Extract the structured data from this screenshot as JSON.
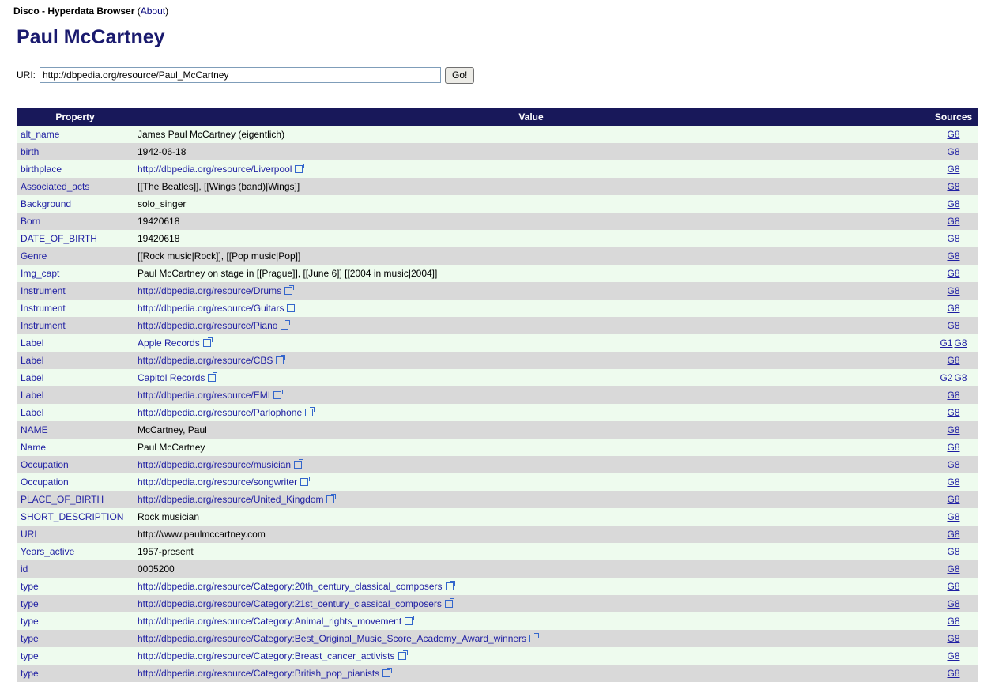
{
  "header": {
    "app_title": "Disco - Hyperdata Browser",
    "about_open": "(",
    "about_label": "About",
    "about_close": ")"
  },
  "page_title": "Paul McCartney",
  "uri_bar": {
    "label": "URI:",
    "value": "http://dbpedia.org/resource/Paul_McCartney",
    "go_label": "Go!"
  },
  "table": {
    "headers": [
      "Property",
      "Value",
      "Sources"
    ],
    "rows": [
      {
        "property": "alt_name",
        "value": "James Paul McCartney (eigentlich)",
        "link": false,
        "sources": [
          "G8"
        ]
      },
      {
        "property": "birth",
        "value": "1942-06-18",
        "link": false,
        "sources": [
          "G8"
        ]
      },
      {
        "property": "birthplace",
        "value": "http://dbpedia.org/resource/Liverpool",
        "link": true,
        "sources": [
          "G8"
        ]
      },
      {
        "property": "Associated_acts",
        "value": "[[The Beatles]], [[Wings (band)|Wings]]",
        "link": false,
        "sources": [
          "G8"
        ]
      },
      {
        "property": "Background",
        "value": "solo_singer",
        "link": false,
        "sources": [
          "G8"
        ]
      },
      {
        "property": "Born",
        "value": "19420618",
        "link": false,
        "sources": [
          "G8"
        ]
      },
      {
        "property": "DATE_OF_BIRTH",
        "value": "19420618",
        "link": false,
        "sources": [
          "G8"
        ]
      },
      {
        "property": "Genre",
        "value": "[[Rock music|Rock]], [[Pop music|Pop]]",
        "link": false,
        "sources": [
          "G8"
        ]
      },
      {
        "property": "Img_capt",
        "value": "Paul McCartney on stage in [[Prague]], [[June 6]] [[2004 in music|2004]]",
        "link": false,
        "sources": [
          "G8"
        ]
      },
      {
        "property": "Instrument",
        "value": "http://dbpedia.org/resource/Drums",
        "link": true,
        "sources": [
          "G8"
        ]
      },
      {
        "property": "Instrument",
        "value": "http://dbpedia.org/resource/Guitars",
        "link": true,
        "sources": [
          "G8"
        ]
      },
      {
        "property": "Instrument",
        "value": "http://dbpedia.org/resource/Piano",
        "link": true,
        "sources": [
          "G8"
        ]
      },
      {
        "property": "Label",
        "value": "Apple Records",
        "link": true,
        "sources": [
          "G1",
          "G8"
        ]
      },
      {
        "property": "Label",
        "value": "http://dbpedia.org/resource/CBS",
        "link": true,
        "sources": [
          "G8"
        ]
      },
      {
        "property": "Label",
        "value": "Capitol Records",
        "link": true,
        "sources": [
          "G2",
          "G8"
        ]
      },
      {
        "property": "Label",
        "value": "http://dbpedia.org/resource/EMI",
        "link": true,
        "sources": [
          "G8"
        ]
      },
      {
        "property": "Label",
        "value": "http://dbpedia.org/resource/Parlophone",
        "link": true,
        "sources": [
          "G8"
        ]
      },
      {
        "property": "NAME",
        "value": "McCartney, Paul",
        "link": false,
        "sources": [
          "G8"
        ]
      },
      {
        "property": "Name",
        "value": "Paul McCartney",
        "link": false,
        "sources": [
          "G8"
        ]
      },
      {
        "property": "Occupation",
        "value": "http://dbpedia.org/resource/musician",
        "link": true,
        "sources": [
          "G8"
        ]
      },
      {
        "property": "Occupation",
        "value": "http://dbpedia.org/resource/songwriter",
        "link": true,
        "sources": [
          "G8"
        ]
      },
      {
        "property": "PLACE_OF_BIRTH",
        "value": "http://dbpedia.org/resource/United_Kingdom",
        "link": true,
        "sources": [
          "G8"
        ]
      },
      {
        "property": "SHORT_DESCRIPTION",
        "value": "Rock musician",
        "link": false,
        "sources": [
          "G8"
        ]
      },
      {
        "property": "URL",
        "value": "http://www.paulmccartney.com",
        "link": false,
        "sources": [
          "G8"
        ]
      },
      {
        "property": "Years_active",
        "value": "1957-present",
        "link": false,
        "sources": [
          "G8"
        ]
      },
      {
        "property": "id",
        "value": "0005200",
        "link": false,
        "sources": [
          "G8"
        ]
      },
      {
        "property": "type",
        "value": "http://dbpedia.org/resource/Category:20th_century_classical_composers",
        "link": true,
        "sources": [
          "G8"
        ]
      },
      {
        "property": "type",
        "value": "http://dbpedia.org/resource/Category:21st_century_classical_composers",
        "link": true,
        "sources": [
          "G8"
        ]
      },
      {
        "property": "type",
        "value": "http://dbpedia.org/resource/Category:Animal_rights_movement",
        "link": true,
        "sources": [
          "G8"
        ]
      },
      {
        "property": "type",
        "value": "http://dbpedia.org/resource/Category:Best_Original_Music_Score_Academy_Award_winners",
        "link": true,
        "sources": [
          "G8"
        ]
      },
      {
        "property": "type",
        "value": "http://dbpedia.org/resource/Category:Breast_cancer_activists",
        "link": true,
        "sources": [
          "G8"
        ]
      },
      {
        "property": "type",
        "value": "http://dbpedia.org/resource/Category:British_pop_pianists",
        "link": true,
        "sources": [
          "G8"
        ]
      }
    ]
  }
}
